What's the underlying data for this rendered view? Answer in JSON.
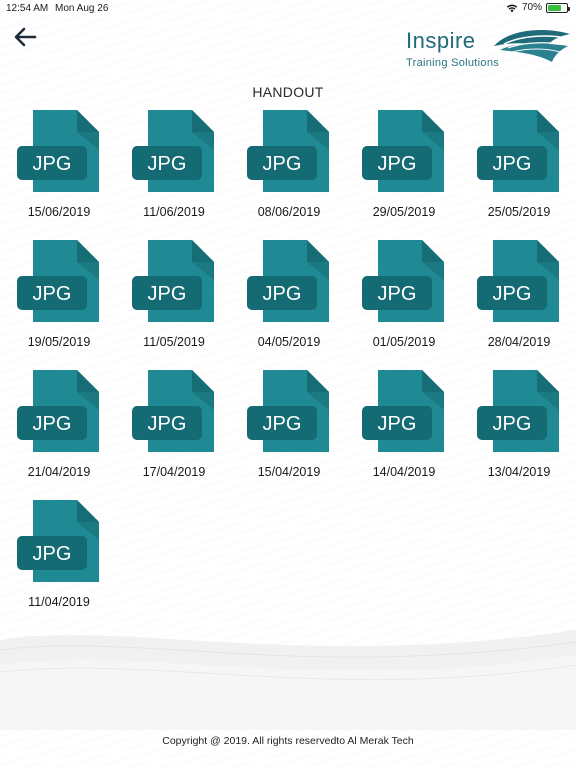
{
  "status": {
    "time": "12:54 AM",
    "date": "Mon Aug 26",
    "battery": "70%",
    "battery_level": 0.7,
    "wifi_icon": "wifi-icon"
  },
  "header": {
    "back_icon": "arrow-left-icon",
    "logo_word": "Inspire",
    "logo_sub": "Training Solutions"
  },
  "page_title": "HANDOUT",
  "files": [
    {
      "type": "JPG",
      "date": "15/06/2019"
    },
    {
      "type": "JPG",
      "date": "11/06/2019"
    },
    {
      "type": "JPG",
      "date": "08/06/2019"
    },
    {
      "type": "JPG",
      "date": "29/05/2019"
    },
    {
      "type": "JPG",
      "date": "25/05/2019"
    },
    {
      "type": "JPG",
      "date": "19/05/2019"
    },
    {
      "type": "JPG",
      "date": "11/05/2019"
    },
    {
      "type": "JPG",
      "date": "04/05/2019"
    },
    {
      "type": "JPG",
      "date": "01/05/2019"
    },
    {
      "type": "JPG",
      "date": "28/04/2019"
    },
    {
      "type": "JPG",
      "date": "21/04/2019"
    },
    {
      "type": "JPG",
      "date": "17/04/2019"
    },
    {
      "type": "JPG",
      "date": "15/04/2019"
    },
    {
      "type": "JPG",
      "date": "14/04/2019"
    },
    {
      "type": "JPG",
      "date": "13/04/2019"
    },
    {
      "type": "JPG",
      "date": "11/04/2019"
    }
  ],
  "colors": {
    "file_body": "#1f8a94",
    "file_fold": "#166d75",
    "file_badge": "#156b73",
    "accent": "#1f6b7a"
  },
  "footer": "Copyright @ 2019. All rights reservedto Al Merak Tech"
}
